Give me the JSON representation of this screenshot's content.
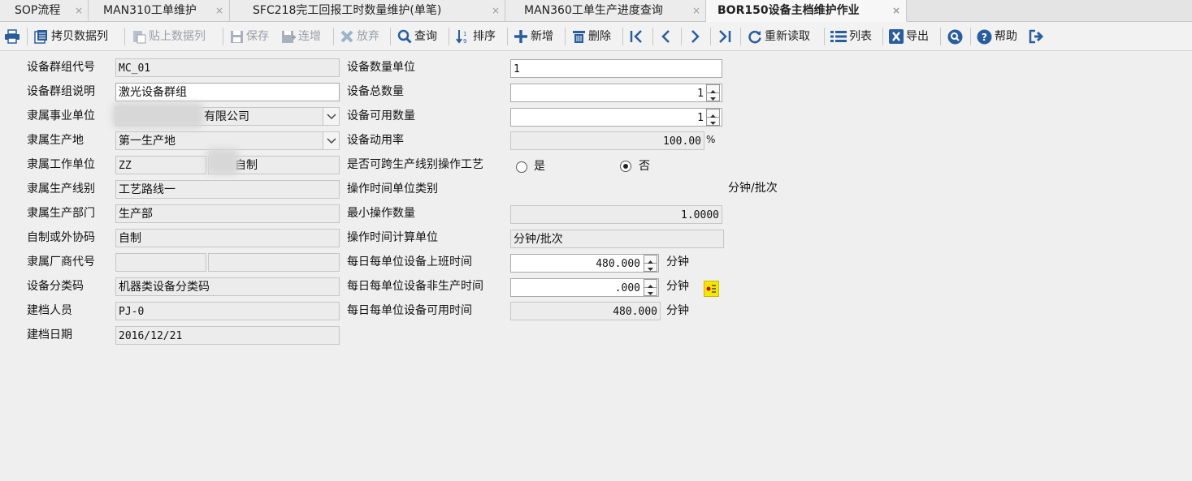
{
  "tabs": [
    {
      "label": "SOP流程",
      "close": "×"
    },
    {
      "label": "MAN310工单维护",
      "close": "×"
    },
    {
      "label": "SFC218完工回报工时数量维护(单笔)",
      "close": "×"
    },
    {
      "label": "MAN360工单生产进度查询",
      "close": "×"
    },
    {
      "label": "BOR150设备主档维护作业",
      "close": "×"
    }
  ],
  "toolbar": {
    "copy_label": "拷贝数据列",
    "paste_label": "贴上数据列",
    "save_label": "保存",
    "continue_add_label": "连增",
    "discard_label": "放弃",
    "query_label": "查询",
    "sort_label": "排序",
    "add_label": "新增",
    "delete_label": "删除",
    "reload_label": "重新读取",
    "list_label": "列表",
    "export_label": "导出",
    "help_label": "帮助"
  },
  "colors": {
    "accent": "#2a5d9f",
    "disabled": "#9aa0a8"
  },
  "form": {
    "group_code_label": "设备群组代号",
    "group_code_value": "MC_01",
    "group_desc_label": "设备群组说明",
    "group_desc_value": "激光设备群组",
    "business_unit_label": "隶属事业单位",
    "business_unit_value": "有限公司",
    "production_site_label": "隶属生产地",
    "production_site_value": "第一生产地",
    "work_unit_label": "隶属工作单位",
    "work_unit_code": "ZZ",
    "work_unit_name": "自制",
    "production_line_label": "隶属生产线别",
    "production_line_value": "工艺路线一",
    "department_label": "隶属生产部门",
    "department_value": "生产部",
    "inhouse_label": "自制或外协码",
    "inhouse_value": "自制",
    "vendor_label": "隶属厂商代号",
    "vendor_code": "",
    "vendor_name": "",
    "category_label": "设备分类码",
    "category_value": "机器类设备分类码",
    "creator_label": "建档人员",
    "creator_value": "PJ-0",
    "create_date_label": "建档日期",
    "create_date_value": "2016/12/21",
    "qty_unit_label": "设备数量单位",
    "qty_unit_value": "1",
    "total_qty_label": "设备总数量",
    "total_qty_value": "1",
    "avail_qty_label": "设备可用数量",
    "avail_qty_value": "1",
    "util_rate_label": "设备动用率",
    "util_rate_value": "100.00",
    "util_rate_unit": "%",
    "cross_line_label": "是否可跨生产线别操作工艺",
    "cross_line_yes": "是",
    "cross_line_no": "否",
    "cross_line_selected": "否",
    "op_time_type_label": "操作时间单位类别",
    "op_time_type_value": "分钟/批次",
    "min_op_qty_label": "最小操作数量",
    "min_op_qty_value": "1.0000",
    "op_time_calc_label": "操作时间计算单位",
    "op_time_calc_value": "分钟/批次",
    "daily_work_label": "每日每单位设备上班时间",
    "daily_work_value": "480.000",
    "daily_nonprod_label": "每日每单位设备非生产时间",
    "daily_nonprod_value": ".000",
    "daily_avail_label": "每日每单位设备可用时间",
    "daily_avail_value": "480.000",
    "minute_unit": "分钟"
  }
}
